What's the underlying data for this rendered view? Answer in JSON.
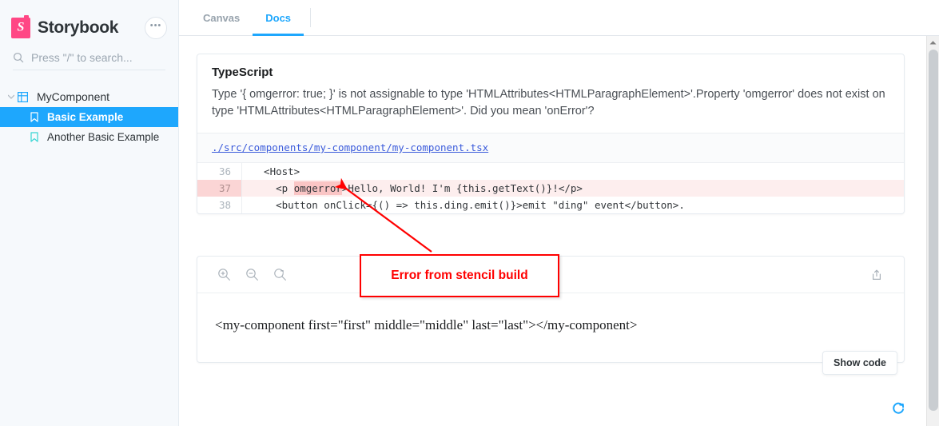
{
  "brand": {
    "name": "Storybook",
    "logo_letter": "S",
    "logo_color": "#FF4785",
    "accent_color": "#1EA7FD"
  },
  "sidebar": {
    "menu_button_label": "•••",
    "search": {
      "placeholder": "Press \"/\" to search...",
      "icon": "search-icon"
    },
    "tree": {
      "root": {
        "label": "MyComponent",
        "icon": "component-grid-icon",
        "expanded": true
      },
      "stories": [
        {
          "label": "Basic Example",
          "icon": "bookmark-icon",
          "selected": true
        },
        {
          "label": "Another Basic Example",
          "icon": "bookmark-icon",
          "selected": false
        }
      ]
    }
  },
  "tabs": [
    {
      "label": "Canvas",
      "active": false
    },
    {
      "label": "Docs",
      "active": true
    }
  ],
  "error_panel": {
    "title": "TypeScript",
    "message": "Type '{ omgerror: true; }' is not assignable to type 'HTMLAttributes<HTMLParagraphElement>'.Property 'omgerror' does not exist on type 'HTMLAttributes<HTMLParagraphElement>'. Did you mean 'onError'?",
    "file_path": "./src/components/my-component/my-component.tsx",
    "code_lines": [
      {
        "number": "36",
        "pre": "  <Host>",
        "token": "",
        "post": "",
        "highlighted": false
      },
      {
        "number": "37",
        "pre": "    <p ",
        "token": "omgerror",
        "post": ">Hello, World! I'm {this.getText()}!</p>",
        "highlighted": true
      },
      {
        "number": "38",
        "pre": "    <button onClick={() => this.ding.emit()}>emit \"ding\" event</button>.",
        "token": "",
        "post": "",
        "highlighted": false
      }
    ]
  },
  "preview": {
    "toolbar": {
      "zoom_in": "zoom-in-icon",
      "zoom_out": "zoom-out-icon",
      "zoom_reset": "zoom-reset-icon",
      "open_external": "open-external-icon"
    },
    "rendered_markup": "<my-component first=\"first\" middle=\"middle\" last=\"last\"></my-component>",
    "show_code_label": "Show code"
  },
  "annotation": {
    "text": "Error from stencil build",
    "color": "#FF0000"
  },
  "status": {
    "spinner": "loading-refresh-icon",
    "spinner_color": "#1EA7FD"
  }
}
